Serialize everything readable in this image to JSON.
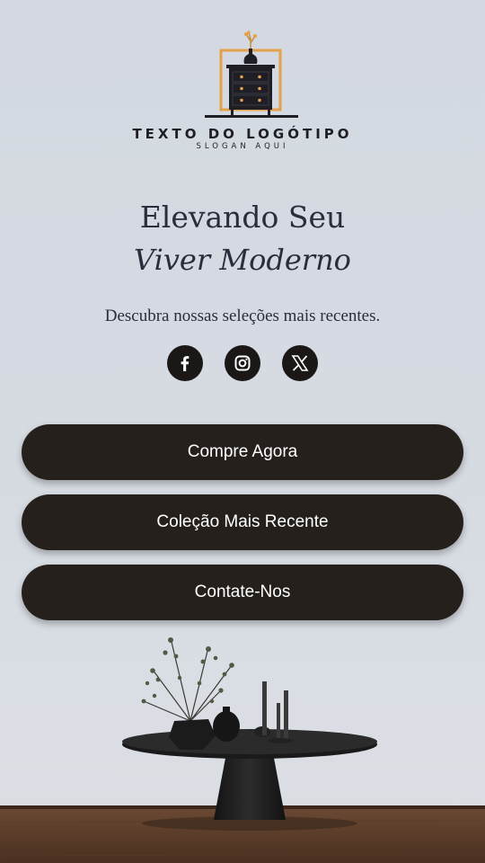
{
  "logo": {
    "title": "TEXTO DO LOGÓTIPO",
    "slogan": "SLOGAN AQUI",
    "icon": "dresser-with-vase-icon",
    "accent": "#e2a14a"
  },
  "hero": {
    "headline": "Elevando Seu",
    "script": "Viver Moderno",
    "subtitle": "Descubra nossas seleções mais recentes."
  },
  "socials": [
    {
      "icon": "facebook-icon"
    },
    {
      "icon": "instagram-icon"
    },
    {
      "icon": "x-twitter-icon"
    }
  ],
  "buttons": {
    "shop": "Compre Agora",
    "collection": "Coleção Mais Recente",
    "contact": "Contate-Nos"
  },
  "colors": {
    "background": "#d5dae1",
    "button": "#26201c",
    "button_text": "#ffffff",
    "text": "#2c2c3d"
  }
}
